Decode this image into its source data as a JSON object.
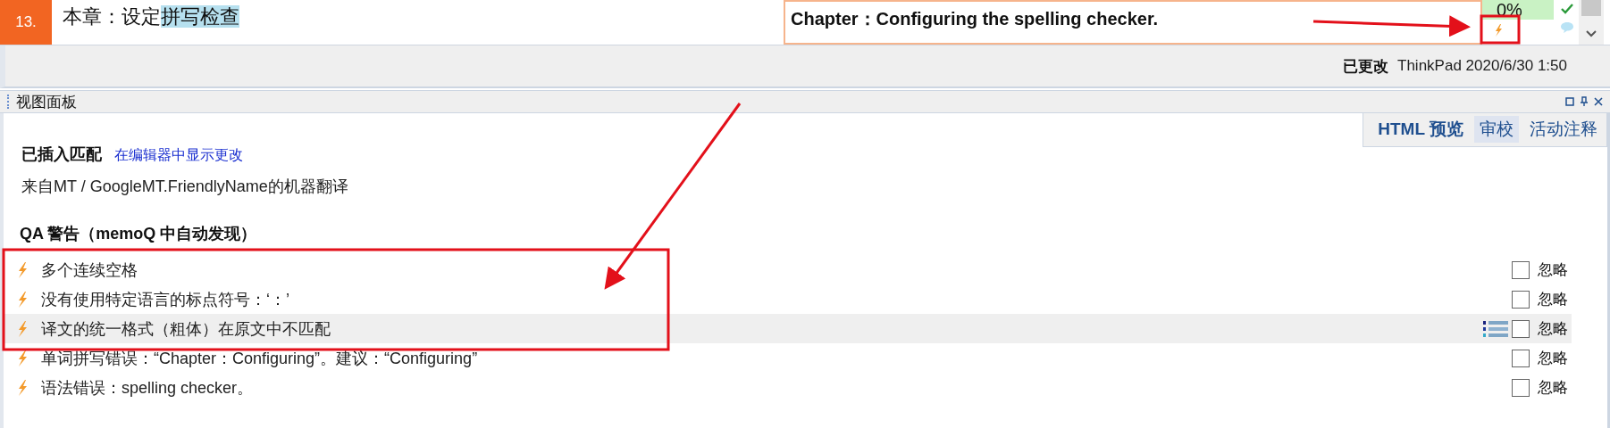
{
  "segment": {
    "number": "13.",
    "source": [
      {
        "text": "本章：设定",
        "highlighted": false
      },
      {
        "text": "拼写检查",
        "highlighted": true
      }
    ],
    "target": "Chapter：Configuring the spelling  checker.",
    "match": "0%",
    "confirmed": true,
    "has_comment": true,
    "has_warning": true
  },
  "status": {
    "label": "已更改",
    "user": "ThinkPad 2020/6/30 1:50"
  },
  "panel": {
    "title": "视图面板",
    "tabs": [
      {
        "label": "HTML 预览",
        "selected": false
      },
      {
        "label": "审校",
        "selected": true
      },
      {
        "label": "活动注释",
        "selected": false
      }
    ],
    "match_heading": "已插入匹配",
    "match_link": "在编辑器中显示更改",
    "match_source": "来自MT / GoogleMT.FriendlyName的机器翻译",
    "qa_heading": "QA 警告（memoQ 中自动发现）",
    "warnings": [
      {
        "text": "多个连续空格",
        "selected": false,
        "ignored": false,
        "ignore_label": "忽略"
      },
      {
        "text": "没有使用特定语言的标点符号：‘：’",
        "selected": false,
        "ignored": false,
        "ignore_label": "忽略"
      },
      {
        "text": "译文的统一格式（粗体）在原文中不匹配",
        "selected": true,
        "ignored": false,
        "ignore_label": "忽略"
      },
      {
        "text": "单词拼写错误：“Chapter：Configuring”。建议：“Configuring”",
        "selected": false,
        "ignored": false,
        "ignore_label": "忽略"
      },
      {
        "text": "语法错误：spelling  checker。",
        "selected": false,
        "ignored": false,
        "ignore_label": "忽略"
      }
    ]
  }
}
